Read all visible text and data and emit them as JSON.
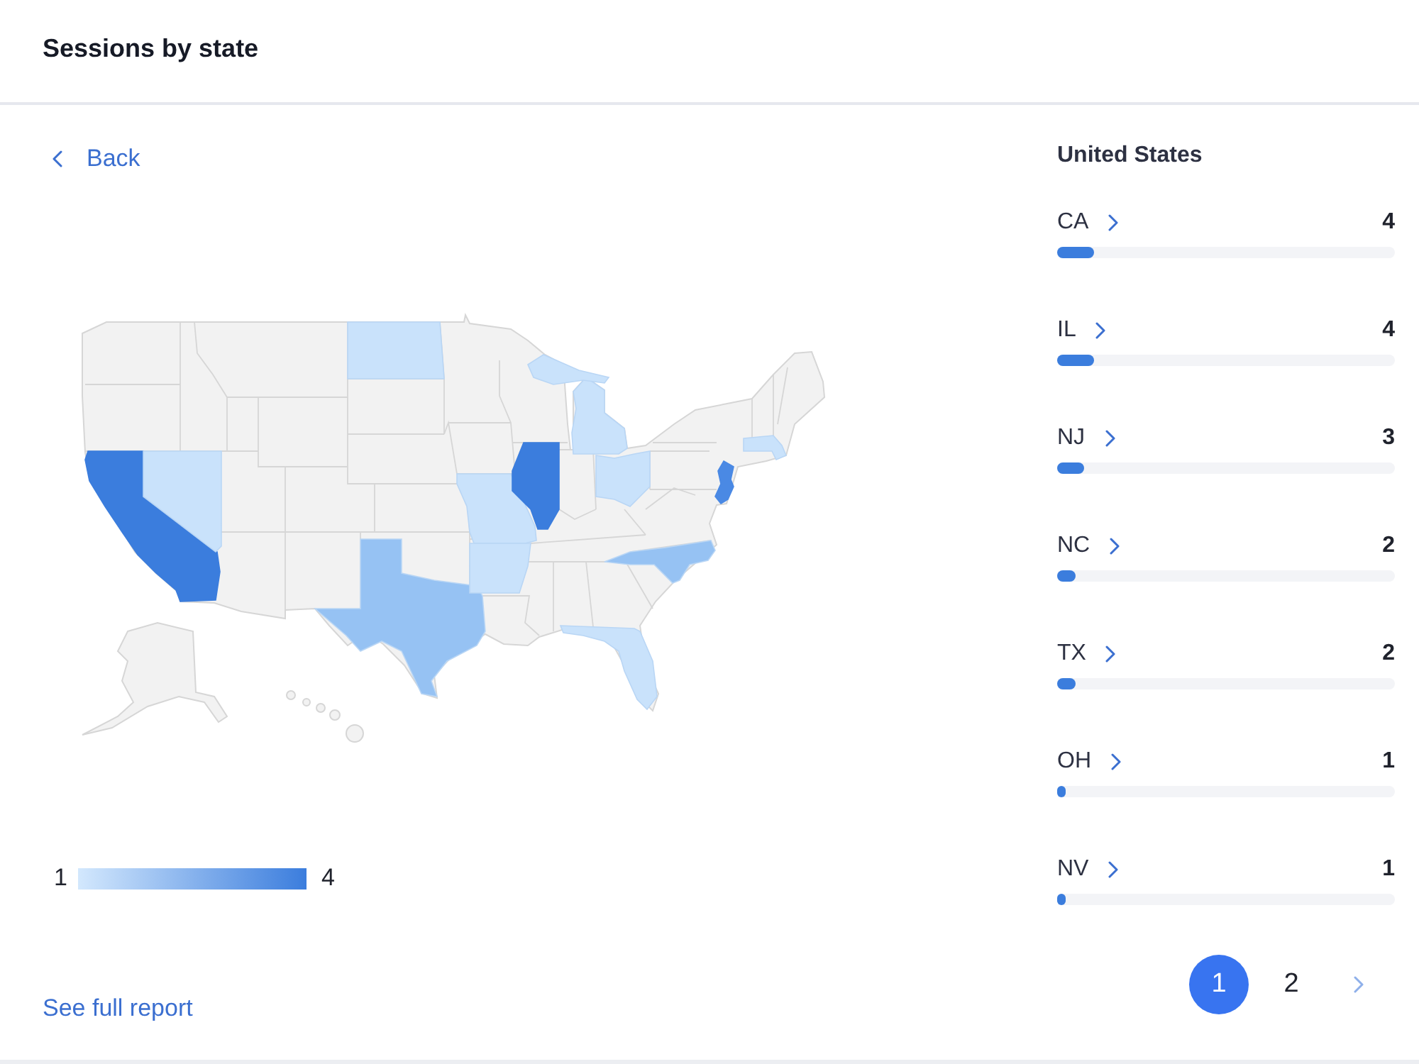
{
  "header": {
    "title": "Sessions by state"
  },
  "map_panel": {
    "back_link": "Back",
    "legend": {
      "min": "1",
      "max": "4"
    },
    "report_link": "See full report"
  },
  "state_list": {
    "title": "United States",
    "rows": [
      {
        "code": "CA",
        "count": "4",
        "level": 0.11
      },
      {
        "code": "IL",
        "count": "4",
        "level": 0.11
      },
      {
        "code": "NJ",
        "count": "3",
        "level": 0.08
      },
      {
        "code": "NC",
        "count": "2",
        "level": 0.055
      },
      {
        "code": "TX",
        "count": "2",
        "level": 0.055
      },
      {
        "code": "OH",
        "count": "1",
        "level": 0.025
      },
      {
        "code": "NV",
        "count": "1",
        "level": 0.025
      }
    ]
  },
  "pagination": {
    "pages": [
      {
        "label": "1",
        "selected": true
      },
      {
        "label": "2",
        "selected": false
      }
    ]
  }
}
